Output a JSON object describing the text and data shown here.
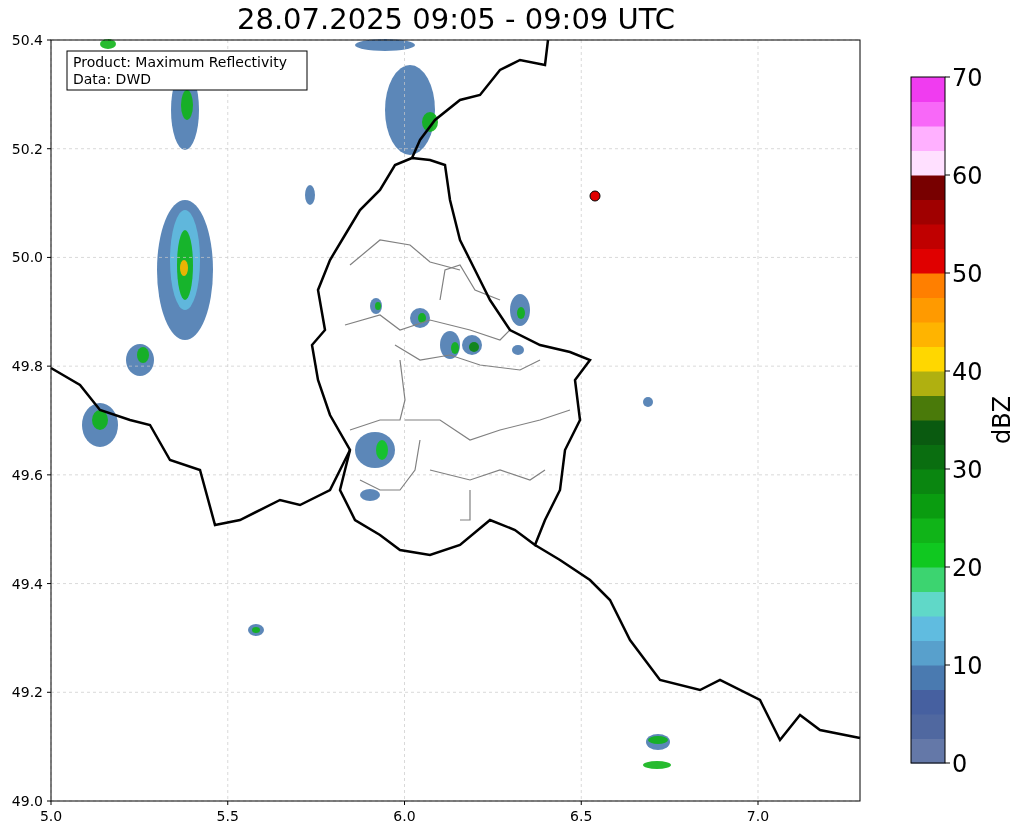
{
  "title": "28.07.2025 09:05 - 09:09 UTC",
  "map": {
    "info_box": {
      "lines": [
        "Product: Maximum Reflectivity",
        "Data: DWD"
      ]
    },
    "xticks": [
      "5.0",
      "5.5",
      "6.0",
      "6.5",
      "7.0"
    ],
    "yticks": [
      "50.4",
      "50.2",
      "50.0",
      "49.8",
      "49.6",
      "49.4",
      "49.2",
      "49.0"
    ]
  },
  "colorbar": {
    "label": "dBZ",
    "ticks": [
      "70",
      "60",
      "50",
      "40",
      "30",
      "20",
      "10",
      "0"
    ],
    "segments": [
      {
        "color": "#6478a8"
      },
      {
        "color": "#5068a0"
      },
      {
        "color": "#4660a0"
      },
      {
        "color": "#4a7ab0"
      },
      {
        "color": "#58a0cc"
      },
      {
        "color": "#60bce0"
      },
      {
        "color": "#60d8c8"
      },
      {
        "color": "#3cd470"
      },
      {
        "color": "#10c820"
      },
      {
        "color": "#10b418"
      },
      {
        "color": "#0a9c10"
      },
      {
        "color": "#0a8610"
      },
      {
        "color": "#0a6e10"
      },
      {
        "color": "#0a5a10"
      },
      {
        "color": "#4a7a0a"
      },
      {
        "color": "#b0b010"
      },
      {
        "color": "#ffd700"
      },
      {
        "color": "#ffb400"
      },
      {
        "color": "#ff9a00"
      },
      {
        "color": "#ff7f00"
      },
      {
        "color": "#e00000"
      },
      {
        "color": "#c00000"
      },
      {
        "color": "#a00000"
      },
      {
        "color": "#780000"
      },
      {
        "color": "#ffe0ff"
      },
      {
        "color": "#ffb0ff"
      },
      {
        "color": "#f868f8"
      },
      {
        "color": "#f03cf0"
      }
    ]
  }
}
